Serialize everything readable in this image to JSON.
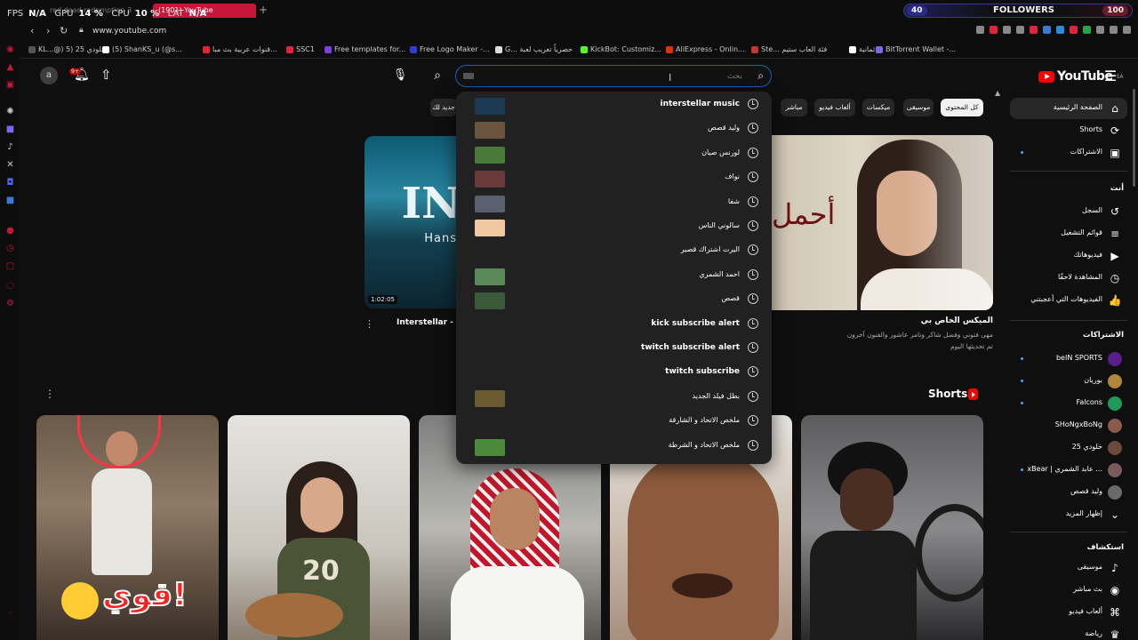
{
  "overlay": {
    "fps_label": "FPS",
    "fps": "N/A",
    "gpu_label": "GPU",
    "gpu": "14 %",
    "cpu_label": "CPU",
    "cpu": "10 %",
    "lat_label": "LAT",
    "lat": "N/A"
  },
  "tabs": [
    {
      "label": "red dead redemption 3 -"
    },
    {
      "label": "(1901) YouTube"
    }
  ],
  "followers": {
    "left_count": "40",
    "label": "FOLLOWERS",
    "right_count": "100"
  },
  "browser": {
    "url": "www.youtube.com"
  },
  "bookmarks": [
    {
      "label": "KL...@) خلودي 25 (5",
      "color": "#555555"
    },
    {
      "label": "(5) ShanKS_u (@s...",
      "color": "#ffffff"
    },
    {
      "label": "قنوات عربية بث مبا...",
      "color": "#e0243c"
    },
    {
      "label": "SSC1",
      "color": "#e0243c"
    },
    {
      "label": "Free templates for...",
      "color": "#7b3fe4"
    },
    {
      "label": "Free Logo Maker -...",
      "color": "#2b3fd6"
    },
    {
      "label": "G... حصرياً تعريب لعبة",
      "color": "#dddddd"
    },
    {
      "label": "KickBot: Customiz...",
      "color": "#53fc18"
    },
    {
      "label": "AliExpress - Onlin...",
      "color": "#e62e04"
    },
    {
      "label": "Ste... فئة العاب ستيم",
      "color": "#c0392b"
    },
    {
      "label": "ثمانية",
      "color": "#ffffff"
    },
    {
      "label": "BitTorrent Wallet -...",
      "color": "#7b68ee"
    }
  ],
  "masthead": {
    "logo_text": "YouTube",
    "country": "SA",
    "avatar_letter": "a",
    "bell_badge": "9+",
    "search_placeholder": "بحث"
  },
  "suggestions": [
    {
      "text": "interstellar music",
      "thumb": "#1c3a52",
      "latin": true
    },
    {
      "text": "وليد قصص",
      "thumb": "#6a5440",
      "latin": false
    },
    {
      "text": "لورنس صيان",
      "thumb": "#4a7a3a",
      "latin": false
    },
    {
      "text": "نواف",
      "thumb": "#6a3a3a",
      "latin": false
    },
    {
      "text": "شفا",
      "thumb": "#5a6070",
      "latin": false
    },
    {
      "text": "سالوني الناس",
      "thumb": "#f0c7a0",
      "latin": false
    },
    {
      "text": "اليرت اشتراك قصير",
      "thumb": "",
      "latin": false
    },
    {
      "text": "احمد الشمري",
      "thumb": "#5a8a5a",
      "latin": false
    },
    {
      "text": "قصص",
      "thumb": "#3a5a3a",
      "latin": false
    },
    {
      "text": "kick subscribe alert",
      "thumb": "",
      "latin": true
    },
    {
      "text": "twitch subscribe alert",
      "thumb": "",
      "latin": true
    },
    {
      "text": "twitch subscribe",
      "thumb": "",
      "latin": true
    },
    {
      "text": "بطل فيلد الجديد",
      "thumb": "#6a5a30",
      "latin": false
    },
    {
      "text": "ملخص الاتحاد و الشارقة",
      "thumb": "",
      "latin": false
    },
    {
      "text": "ملخص الاتحاد و الشرطة",
      "thumb": "#4a8a3a",
      "latin": false
    }
  ],
  "chips": [
    {
      "label": "كل المحتوى",
      "active": true
    },
    {
      "label": "موسيقى",
      "active": false
    },
    {
      "label": "ميكسات",
      "active": false
    },
    {
      "label": "ألعاب فيديو",
      "active": false
    },
    {
      "label": "مباشر",
      "active": false
    },
    {
      "label": "جديد لك",
      "active": false
    }
  ],
  "videos": {
    "left": {
      "thumb_text": "IN",
      "thumb_sub": "Hans",
      "duration": "1:02:05",
      "title": "Interstellar - Ha"
    },
    "right": {
      "thumb_calligraphy": "أحمل",
      "title": "الميكس الخاص بي",
      "meta1": "مهى فتوني وفضل شاكر وتامر عاشور والفنون آخرون",
      "meta2": "تم تحديثها اليوم"
    }
  },
  "shorts": {
    "title": "Shorts",
    "short1_caption": "قوي!"
  },
  "guide": {
    "main": [
      {
        "label": "الصفحة الرئيسية",
        "icon": "⌂",
        "active": true
      },
      {
        "label": "Shorts",
        "icon": "⟳",
        "active": false
      },
      {
        "label": "الاشتراكات",
        "icon": "▣",
        "active": false
      }
    ],
    "you_header": "أنت",
    "you": [
      {
        "label": "السجل",
        "icon": "↺"
      },
      {
        "label": "قوائم التشغيل",
        "icon": "≡"
      },
      {
        "label": "فيديوهاتك",
        "icon": "▶"
      },
      {
        "label": "المشاهدة لاحقًا",
        "icon": "◷"
      },
      {
        "label": "الفيديوهات التي أعجبتني",
        "icon": "👍"
      }
    ],
    "subs_header": "الاشتراكات",
    "subs": [
      {
        "label": "beIN SPORTS",
        "color": "#5a1f8a"
      },
      {
        "label": "بوريان",
        "color": "#b0873a"
      },
      {
        "label": "Falcons",
        "color": "#1f9a5a"
      },
      {
        "label": "SHoNgxBoNg",
        "color": "#8a5a4a"
      },
      {
        "label": "خلودي 25",
        "color": "#6a4a3a"
      },
      {
        "label": "xBear | عابد الشمري ...",
        "color": "#7a5a5a"
      },
      {
        "label": "وليد قصص",
        "color": "#6a6a6a"
      }
    ],
    "show_more": "إظهار المزيد",
    "explore_header": "استكشاف",
    "explore": [
      {
        "label": "موسيقى",
        "icon": "♪"
      },
      {
        "label": "بث مباشر",
        "icon": "◉"
      },
      {
        "label": "ألعاب فيديو",
        "icon": "⌘"
      },
      {
        "label": "رياضة",
        "icon": "♛"
      }
    ]
  }
}
